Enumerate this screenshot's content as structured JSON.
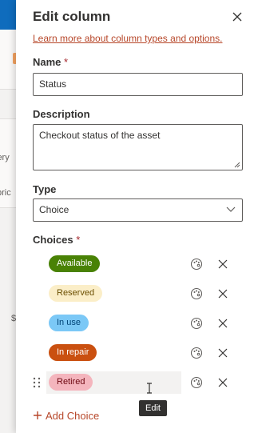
{
  "background": {
    "text_1": "lery",
    "text_2": "pric",
    "text_3": "$"
  },
  "panel": {
    "title": "Edit column",
    "learn_more_link": "Learn more about column types and options.",
    "name_label": "Name",
    "name_required_mark": "*",
    "name_value": "Status",
    "description_label": "Description",
    "description_value": "Checkout status of the asset",
    "type_label": "Type",
    "type_value": "Choice",
    "choices_label": "Choices",
    "choices_required_mark": "*",
    "choices": [
      {
        "label": "Available",
        "bg": "#498205",
        "fg": "#ffffff"
      },
      {
        "label": "Reserved",
        "bg": "#fbeec8",
        "fg": "#6b4e00"
      },
      {
        "label": "In use",
        "bg": "#7bc8f6",
        "fg": "#004377"
      },
      {
        "label": "In repair",
        "bg": "#ca5010",
        "fg": "#ffffff"
      },
      {
        "label": "Retired",
        "bg": "#f4b5bd",
        "fg": "#6e0811"
      }
    ],
    "add_choice_label": "Add Choice",
    "tooltip": "Edit"
  },
  "colors": {
    "accent": "#b7472a",
    "required": "#a4262c"
  },
  "icons": {
    "close": "close-icon",
    "palette": "palette-icon",
    "delete": "delete-icon",
    "chevron": "chevron-down-icon",
    "drag": "drag-handle-icon",
    "plus": "plus-icon"
  }
}
